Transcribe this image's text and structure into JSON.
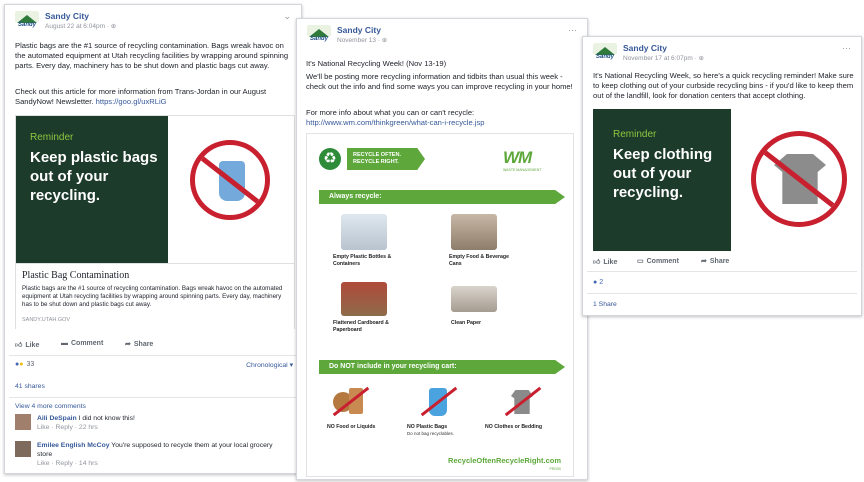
{
  "post1": {
    "page_name": "Sandy City",
    "date": "August 22 at 6:04pm · ",
    "body": "Plastic bags are the #1 source of recycling contamination. Bags wreak havoc on the automated equipment at Utah recycling facilities by wrapping around spinning parts. Every day, machinery has to be shut down and plastic bags cut away.",
    "body2": "Check out this article for more information from Trans-Jordan in our August SandyNow! Newsletter. ",
    "link": "https://goo.gl/uxRLiG",
    "image": {
      "reminder": "Reminder",
      "headline": "Keep plastic bags out of your recycling."
    },
    "card_title": "Plastic Bag Contamination",
    "card_desc": "Plastic bags are the #1 source of recycling contamination. Bags wreak havoc on the automated equipment at Utah recycling facilities by wrapping around spinning parts. Every day, machinery has to be shut down and plastic bags cut away.",
    "card_domain": "SANDY.UTAH.GOV",
    "actions": {
      "like": "Like",
      "comment": "Comment",
      "share": "Share"
    },
    "reactions_count": "33",
    "sort": "Chronological ▾",
    "shares": "41 shares",
    "more_comments": "View 4 more comments",
    "comments": [
      {
        "name": "Aili DeSpain",
        "text": " I did not know this!",
        "meta": "Like · Reply · 22 hrs"
      },
      {
        "name": "Emilee English McCoy",
        "text": " You're supposed to recycle them at your local grocery store",
        "meta": "Like · Reply · 14 hrs"
      }
    ]
  },
  "post2": {
    "page_name": "Sandy City",
    "date": "November 13 · ",
    "line1": "It's National Recycling Week! (Nov 13-19)",
    "line2": "We'll be posting more recycling information and tidbits than usual this week - check out the info and find some ways you can improve recycling in your home!",
    "line3": "For more info about what you can or can't recycle:",
    "link": "http://www.wm.com/thinkgreen/what-can-i-recycle.jsp",
    "infographic": {
      "banner": "RECYCLE OFTEN. RECYCLE RIGHT.",
      "wm_logo": "WM",
      "wm_sub": "WASTE MANAGEMENT",
      "always": "Always recycle:",
      "items": [
        "Empty Plastic Bottles & Containers",
        "Empty Food & Beverage Cans",
        "Flattened Cardboard & Paperboard",
        "Clean Paper"
      ],
      "donot": "Do NOT include in your recycling cart:",
      "no_items": [
        "NO Food or Liquids",
        "NO Plastic Bags",
        "NO Clothes or Bedding"
      ],
      "no_bags_note": "Do not bag recyclables.",
      "footer": "RecycleOftenRecycleRight.com",
      "footer_sub": "PRO00"
    },
    "menu": "···"
  },
  "post3": {
    "page_name": "Sandy City",
    "date": "November 17 at 6:07pm · ",
    "body": "It's National Recycling Week, so here's a quick recycling reminder! Make sure to keep clothing out of your curbside recycling bins - if you'd like to keep them out of the landfill, look for donation centers that accept clothing.",
    "image": {
      "reminder": "Reminder",
      "headline": "Keep clothing out of your recycling."
    },
    "actions": {
      "like": "Like",
      "comment": "Comment",
      "share": "Share"
    },
    "reactions_count": "2",
    "shares": "1 Share",
    "menu": "···"
  },
  "colors": {
    "link": "#365899",
    "green_dark": "#1d3b2a",
    "green_light": "#8cc63f",
    "red": "#c8202f",
    "wm_green": "#5ea83b"
  }
}
